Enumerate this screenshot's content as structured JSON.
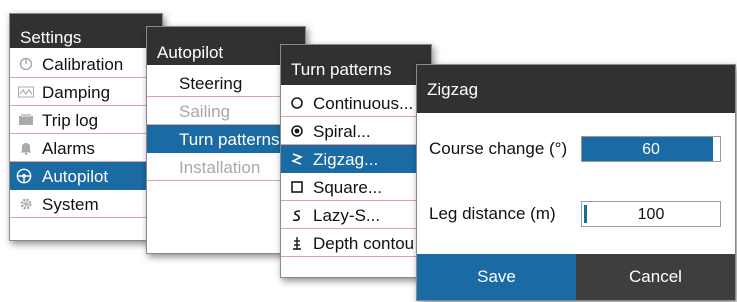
{
  "settings": {
    "title": "Settings",
    "items": [
      {
        "label": "Calibration",
        "icon": "calibration-icon"
      },
      {
        "label": "Damping",
        "icon": "damping-icon"
      },
      {
        "label": "Trip log",
        "icon": "trip-log-icon"
      },
      {
        "label": "Alarms",
        "icon": "alarm-bell-icon"
      },
      {
        "label": "Autopilot",
        "icon": "autopilot-icon",
        "selected": true
      },
      {
        "label": "System",
        "icon": "system-gear-icon"
      }
    ]
  },
  "autopilot": {
    "title": "Autopilot",
    "items": [
      {
        "label": "Steering"
      },
      {
        "label": "Sailing",
        "disabled": true
      },
      {
        "label": "Turn patterns",
        "selected": true
      },
      {
        "label": "Installation",
        "disabled": true
      }
    ]
  },
  "turn_patterns": {
    "title": "Turn patterns",
    "items": [
      {
        "label": "Continuous...",
        "icon": "continuous-circle-icon"
      },
      {
        "label": "Spiral...",
        "icon": "spiral-icon"
      },
      {
        "label": "Zigzag...",
        "icon": "zigzag-icon",
        "selected": true
      },
      {
        "label": "Square...",
        "icon": "square-icon"
      },
      {
        "label": "Lazy-S...",
        "icon": "lazy-s-icon"
      },
      {
        "label": "Depth contou",
        "icon": "depth-contour-icon"
      }
    ]
  },
  "zigzag": {
    "title": "Zigzag",
    "course_change": {
      "label": "Course change (°)",
      "value": "60",
      "level": 0.95
    },
    "leg_distance": {
      "label": "Leg distance (m)",
      "value": "100"
    },
    "save_label": "Save",
    "cancel_label": "Cancel"
  },
  "colors": {
    "accent": "#1a6aa3",
    "header": "#2f3133",
    "cancel": "#3c3e40"
  }
}
